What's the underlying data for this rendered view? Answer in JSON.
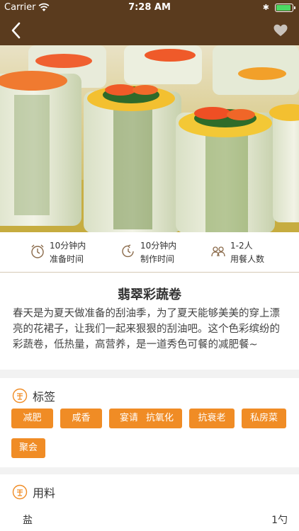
{
  "status_bar": {
    "carrier": "Carrier",
    "time": "7:28 AM"
  },
  "nav": {
    "back_icon": "chevron-left-icon",
    "favorite_icon": "heart-icon"
  },
  "info": [
    {
      "icon": "alarm-clock-icon",
      "value": "10分钟内",
      "label": "准备时间"
    },
    {
      "icon": "timer-icon",
      "value": "10分钟内",
      "label": "制作时间"
    },
    {
      "icon": "diners-icon",
      "value": "1-2人",
      "label": "用餐人数"
    }
  ],
  "recipe": {
    "title": "翡翠彩蔬卷",
    "description": "春天是为夏天做准备的刮油季，为了夏天能够美美的穿上漂亮的花裙子，让我们一起来狠狠的刮油吧。这个色彩缤纷的彩蔬卷，低热量，高营养，是一道秀色可餐的减肥餐~"
  },
  "tags_section": {
    "title": "标签",
    "tags": [
      "减肥",
      "咸香",
      "宴请",
      "抗氧化",
      "抗衰老",
      "私房菜",
      "聚会"
    ]
  },
  "ingredients_section": {
    "title": "用料",
    "items": [
      {
        "name": "盐",
        "amount": "1勺"
      }
    ]
  },
  "colors": {
    "header": "#5a3b1e",
    "accent": "#f08c25",
    "divider": "#d6c9b6"
  }
}
